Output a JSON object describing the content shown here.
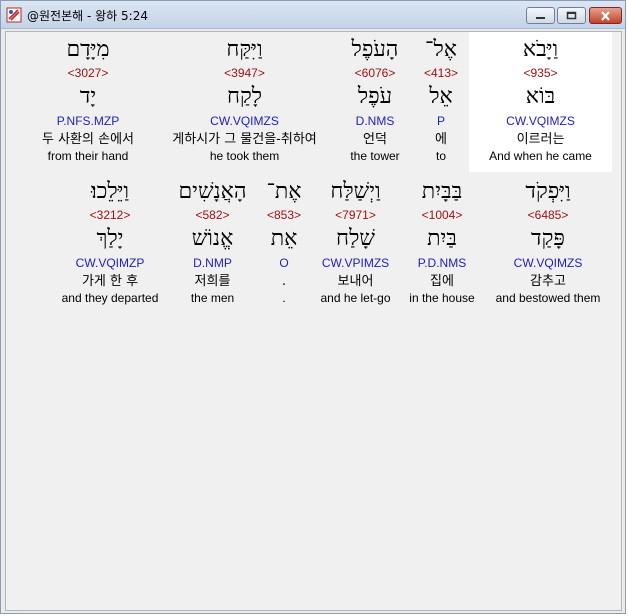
{
  "window": {
    "title": "@원전본해 - 왕하 5:24"
  },
  "rows": [
    {
      "words": [
        {
          "heb": "וַיָּבֹא",
          "code": "<935>",
          "root": "בּוֹא",
          "morph": "CW.VQIMZS",
          "kor": "이르러는",
          "eng": "And when he came",
          "selected": true
        },
        {
          "heb": "אֶל־",
          "code": "<413>",
          "root": "אֵל",
          "morph": "P",
          "kor": "에",
          "eng": "to",
          "selected": false
        },
        {
          "heb": "הָעֹפֶל",
          "code": "<6076>",
          "root": "עֹפֶל",
          "morph": "D.NMS",
          "kor": "언덕",
          "eng": "the tower",
          "selected": false
        },
        {
          "heb": "וַיִּקַּח",
          "code": "<3947>",
          "root": "לָקַח",
          "morph": "CW.VQIMZS",
          "kor": "게하시가 그 물건을-취하여",
          "eng": "he took them",
          "selected": false
        },
        {
          "heb": "מִיָּדָם",
          "code": "<3027>",
          "root": "יָד",
          "morph": "P.NFS.MZP",
          "kor": "두 사환의 손에서",
          "eng": "from their hand",
          "selected": false
        }
      ]
    },
    {
      "words": [
        {
          "heb": "וַיִּפְקֹד",
          "code": "<6485>",
          "root": "פָּקַד",
          "morph": "CW.VQIMZS",
          "kor": "감추고",
          "eng": "and bestowed them",
          "selected": false
        },
        {
          "heb": "בַּבָּיִת",
          "code": "<1004>",
          "root": "בַּיִת",
          "morph": "P.D.NMS",
          "kor": "집에",
          "eng": "in the house",
          "selected": false
        },
        {
          "heb": "וַיְשַׁלַּח",
          "code": "<7971>",
          "root": "שָׁלַח",
          "morph": "CW.VPIMZS",
          "kor": "보내어",
          "eng": "and he let-go",
          "selected": false
        },
        {
          "heb": "אֶת־",
          "code": "<853>",
          "root": "אֵת",
          "morph": "O",
          "kor": ".",
          "eng": ".",
          "selected": false
        },
        {
          "heb": "הָאֲנָשִׁים",
          "code": "<582>",
          "root": "אֱנוֹשׁ",
          "morph": "D.NMP",
          "kor": "저희를",
          "eng": "the men",
          "selected": false
        },
        {
          "heb": "וַיֵּלֵכוּ׃",
          "code": "<3212>",
          "root": "יָלַךְ",
          "morph": "CW.VQIMZP",
          "kor": "가게 한 후",
          "eng": "and they departed",
          "selected": false
        }
      ]
    }
  ]
}
